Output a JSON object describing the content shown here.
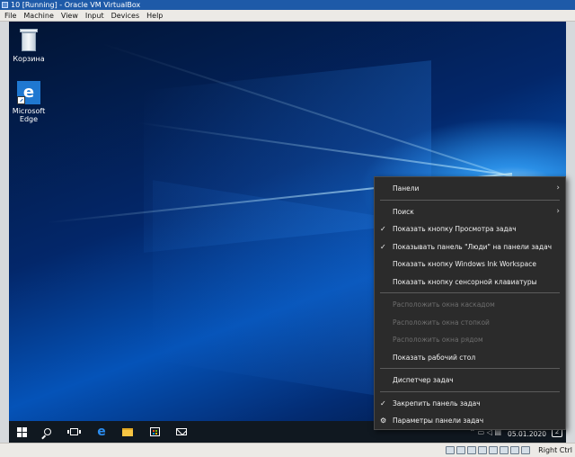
{
  "window": {
    "title": "10 [Running] - Oracle VM VirtualBox"
  },
  "menubar": [
    "File",
    "Machine",
    "View",
    "Input",
    "Devices",
    "Help"
  ],
  "desktop": {
    "icons": [
      {
        "label": "Корзина",
        "icon": "recycle-bin-icon"
      },
      {
        "label": "Microsoft Edge",
        "icon": "edge-icon"
      }
    ]
  },
  "context_menu": {
    "items": [
      {
        "label": "Панели",
        "submenu": true,
        "checked": false,
        "enabled": true
      },
      {
        "separator": true
      },
      {
        "label": "Поиск",
        "submenu": true,
        "checked": false,
        "enabled": true
      },
      {
        "label": "Показать кнопку Просмотра задач",
        "checked": true,
        "enabled": true
      },
      {
        "label": "Показывать панель \"Люди\" на панели задач",
        "checked": true,
        "enabled": true
      },
      {
        "label": "Показать кнопку Windows Ink Workspace",
        "checked": false,
        "enabled": true
      },
      {
        "label": "Показать кнопку сенсорной клавиатуры",
        "checked": false,
        "enabled": true
      },
      {
        "separator": true
      },
      {
        "label": "Расположить окна каскадом",
        "checked": false,
        "enabled": false
      },
      {
        "label": "Расположить окна стопкой",
        "checked": false,
        "enabled": false
      },
      {
        "label": "Расположить окна рядом",
        "checked": false,
        "enabled": false
      },
      {
        "label": "Показать рабочий стол",
        "checked": false,
        "enabled": true
      },
      {
        "separator": true
      },
      {
        "label": "Диспетчер задач",
        "checked": false,
        "enabled": true
      },
      {
        "separator": true
      },
      {
        "label": "Закрепить панель задач",
        "checked": true,
        "enabled": true
      },
      {
        "label": "Параметры панели задач",
        "icon": "gear-icon",
        "checked": false,
        "enabled": true
      }
    ]
  },
  "taskbar": {
    "date": "05.01.2020",
    "notification_count": "2"
  },
  "statusbar": {
    "host_key": "Right Ctrl"
  }
}
